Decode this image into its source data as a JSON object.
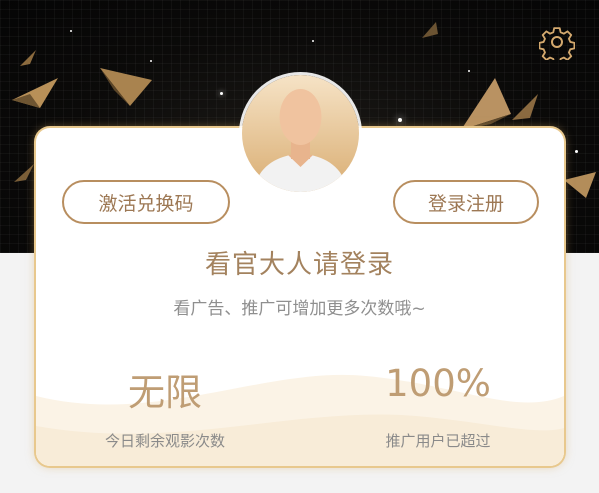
{
  "header": {
    "settings_icon": "settings-gear-icon",
    "accent_color": "#b88e5f"
  },
  "profile": {
    "avatar_icon": "default-user-avatar-icon"
  },
  "actions": {
    "activate_label": "激活兑换码",
    "login_label": "登录注册"
  },
  "prompt": {
    "title": "看官大人请登录",
    "subtitle": "看广告、推广可增加更多次数哦~"
  },
  "stats": {
    "remaining_value": "无限",
    "remaining_label": "今日剩余观影次数",
    "percent_value": "100%",
    "percent_label": "推广用户已超过"
  }
}
